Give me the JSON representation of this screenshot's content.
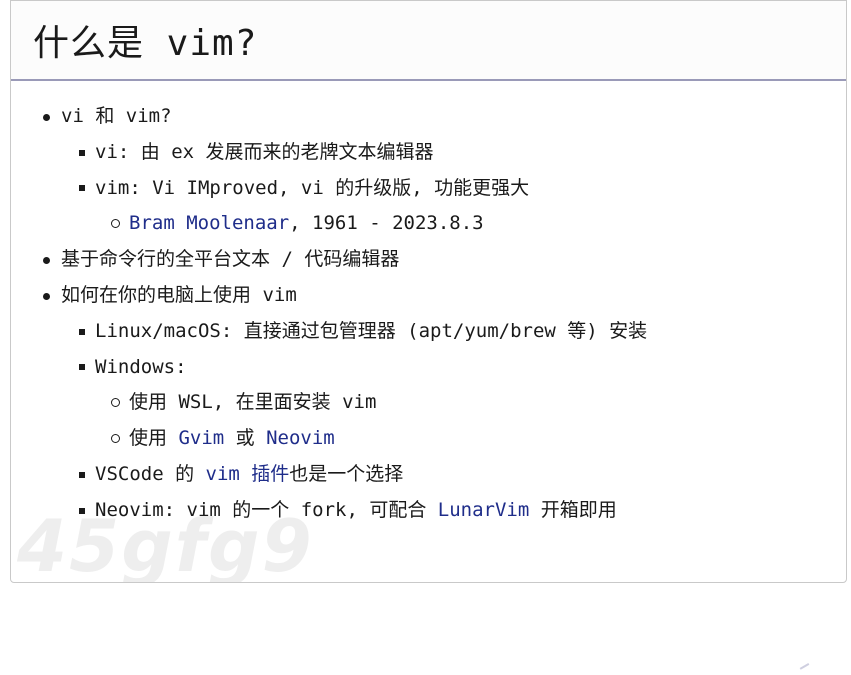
{
  "slide": {
    "title": "什么是 vim?",
    "watermark": "45gfg9",
    "items": [
      {
        "level": 1,
        "segments": [
          {
            "text": "vi 和 vim?"
          }
        ]
      },
      {
        "level": 2,
        "segments": [
          {
            "text": "vi: 由 ex 发展而来的老牌文本编辑器"
          }
        ]
      },
      {
        "level": 2,
        "segments": [
          {
            "text": "vim: Vi IMproved, vi 的升级版, 功能更强大"
          }
        ]
      },
      {
        "level": 3,
        "segments": [
          {
            "text": "Bram Moolenaar",
            "link": true
          },
          {
            "text": ", 1961 - 2023.8.3"
          }
        ]
      },
      {
        "level": 1,
        "segments": [
          {
            "text": "基于命令行的全平台文本 / 代码编辑器"
          }
        ]
      },
      {
        "level": 1,
        "segments": [
          {
            "text": "如何在你的电脑上使用 vim"
          }
        ]
      },
      {
        "level": 2,
        "segments": [
          {
            "text": "Linux/macOS: 直接通过包管理器 (apt/yum/brew 等) 安装"
          }
        ]
      },
      {
        "level": 2,
        "segments": [
          {
            "text": "Windows:"
          }
        ]
      },
      {
        "level": 3,
        "segments": [
          {
            "text": "使用 WSL, 在里面安装 vim"
          }
        ]
      },
      {
        "level": 3,
        "segments": [
          {
            "text": "使用 "
          },
          {
            "text": "Gvim",
            "link": true
          },
          {
            "text": " 或 "
          },
          {
            "text": "Neovim",
            "link": true
          }
        ]
      },
      {
        "level": 2,
        "segments": [
          {
            "text": "VSCode 的 "
          },
          {
            "text": "vim 插件",
            "link": true
          },
          {
            "text": "也是一个选择"
          }
        ]
      },
      {
        "level": 2,
        "segments": [
          {
            "text": "Neovim: vim 的一个 fork, 可配合 "
          },
          {
            "text": "LunarVim",
            "link": true
          },
          {
            "text": " 开箱即用"
          }
        ]
      }
    ]
  },
  "colors": {
    "link": "#1f2d8a",
    "text": "#1a1a1a",
    "title_rule": "#9a9ab8"
  }
}
